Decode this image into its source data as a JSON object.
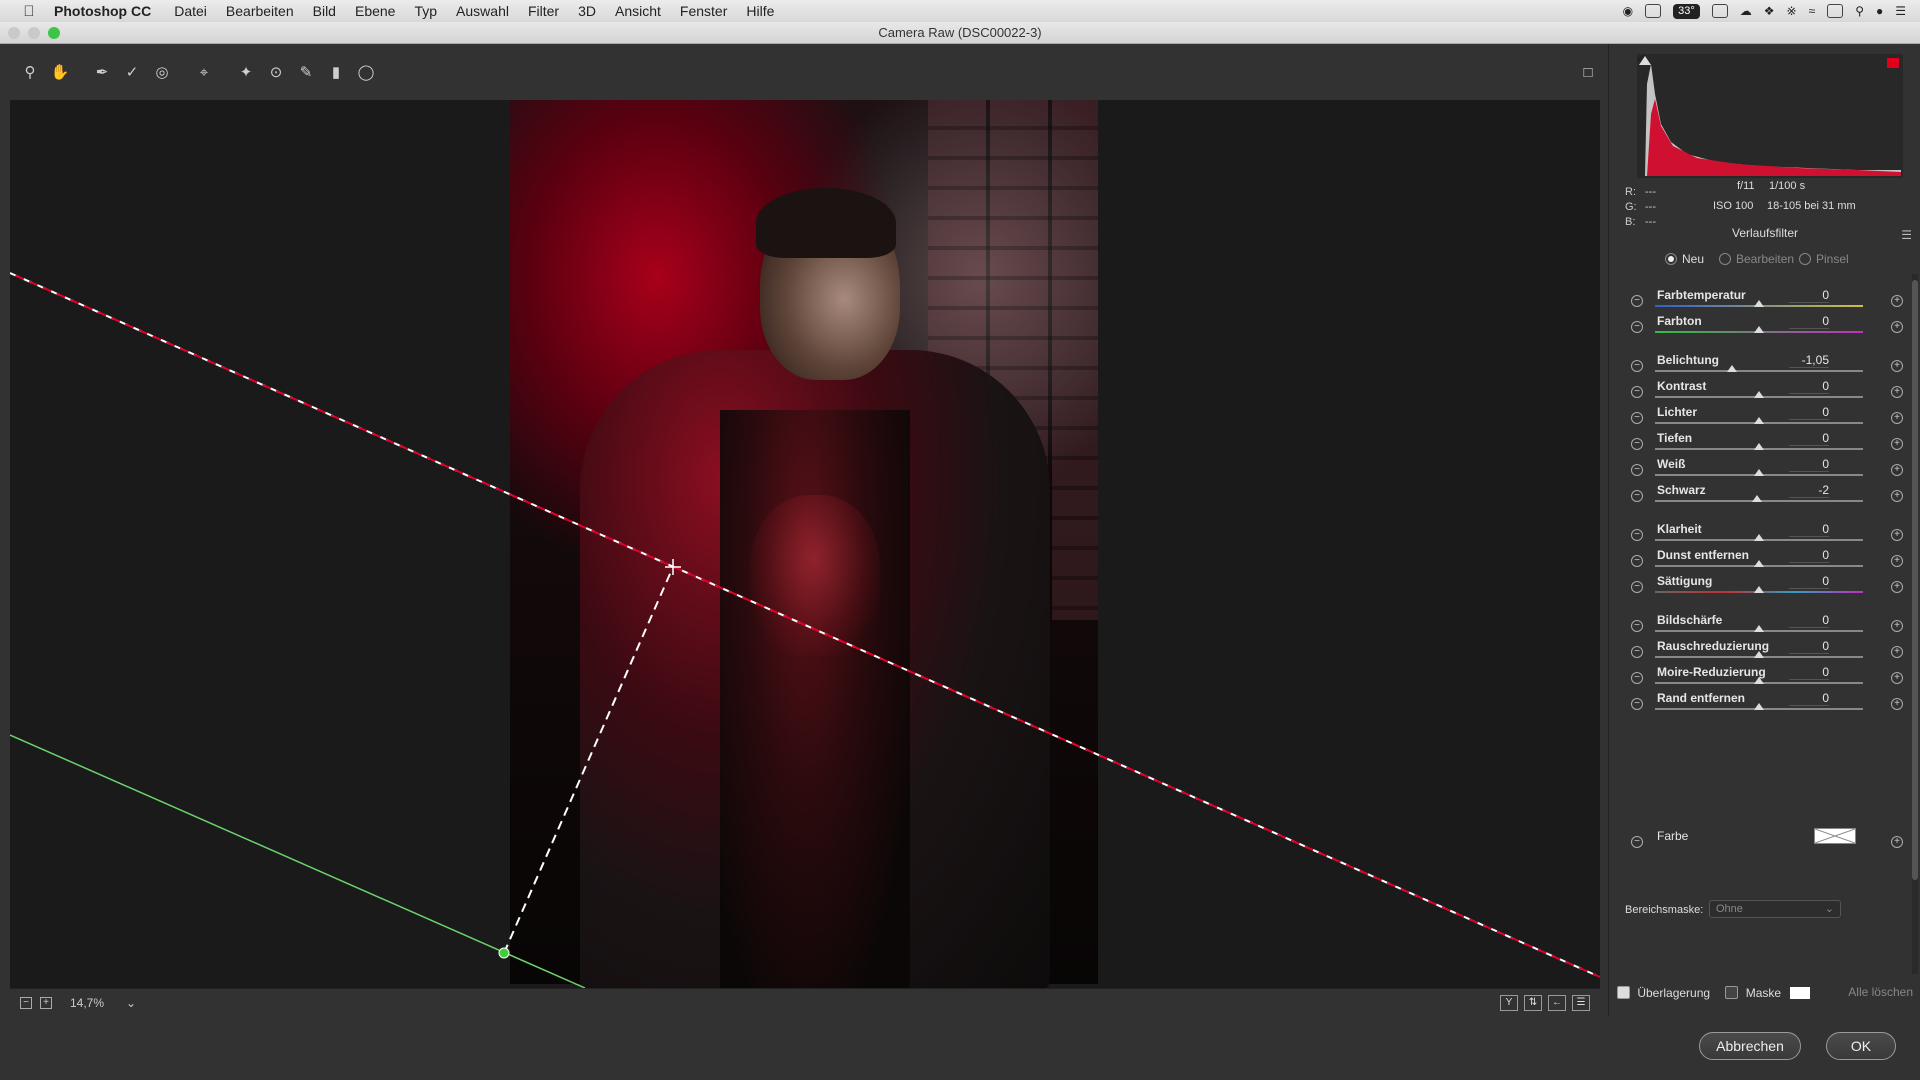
{
  "menubar": {
    "app_name": "Photoshop CC",
    "items": [
      "Datei",
      "Bearbeiten",
      "Bild",
      "Ebene",
      "Typ",
      "Auswahl",
      "Filter",
      "3D",
      "Ansicht",
      "Fenster",
      "Hilfe"
    ],
    "status_badge": "33°"
  },
  "window": {
    "title": "Camera Raw (DSC00022-3)"
  },
  "toolbar": {
    "tools": [
      "zoom-icon",
      "hand-icon",
      "white-balance-icon",
      "color-sampler-icon",
      "target-adjust-icon",
      "crop-icon",
      "spot-removal-icon",
      "red-eye-icon",
      "adjustment-brush-icon",
      "graduated-filter-icon",
      "radial-filter-icon"
    ]
  },
  "bottombar": {
    "zoom": "14,7%"
  },
  "histogram": {
    "r_label": "R:",
    "g_label": "G:",
    "b_label": "B:",
    "r": "---",
    "g": "---",
    "b": "---",
    "aperture": "f/11",
    "shutter": "1/100 s",
    "iso": "ISO 100",
    "lens": "18-105 bei 31 mm"
  },
  "panel": {
    "title": "Verlaufsfilter",
    "modes": [
      {
        "label": "Neu",
        "selected": true
      },
      {
        "label": "Bearbeiten",
        "selected": false
      },
      {
        "label": "Pinsel",
        "selected": false
      }
    ],
    "sliders": [
      {
        "label": "Farbtemperatur",
        "value": "0",
        "pos": 0.5
      },
      {
        "label": "Farbton",
        "value": "0",
        "pos": 0.5
      },
      {
        "label": "Belichtung",
        "value": "-1,05",
        "pos": 0.37
      },
      {
        "label": "Kontrast",
        "value": "0",
        "pos": 0.5
      },
      {
        "label": "Lichter",
        "value": "0",
        "pos": 0.5
      },
      {
        "label": "Tiefen",
        "value": "0",
        "pos": 0.5
      },
      {
        "label": "Weiß",
        "value": "0",
        "pos": 0.5
      },
      {
        "label": "Schwarz",
        "value": "-2",
        "pos": 0.49
      },
      {
        "label": "Klarheit",
        "value": "0",
        "pos": 0.5
      },
      {
        "label": "Dunst entfernen",
        "value": "0",
        "pos": 0.5
      },
      {
        "label": "Sättigung",
        "value": "0",
        "pos": 0.5
      },
      {
        "label": "Bildschärfe",
        "value": "0",
        "pos": 0.5
      },
      {
        "label": "Rauschreduzierung",
        "value": "0",
        "pos": 0.5
      },
      {
        "label": "Moire-Reduzierung",
        "value": "0",
        "pos": 0.5
      },
      {
        "label": "Rand entfernen",
        "value": "0",
        "pos": 0.5
      }
    ],
    "farbe_label": "Farbe",
    "bereichsmaske_label": "Bereichsmaske:",
    "bereichsmaske_value": "Ohne",
    "overlay_label": "Überlagerung",
    "mask_label": "Maske",
    "clear_all_label": "Alle löschen"
  },
  "footer": {
    "cancel_label": "Abbrechen",
    "ok_label": "OK"
  }
}
